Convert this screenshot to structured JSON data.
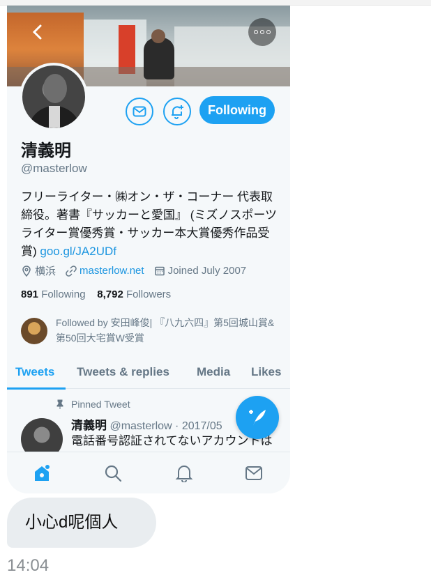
{
  "profile": {
    "name": "清義明",
    "handle": "@masterlow",
    "bio_text": "フリーライター・㈱オン・ザ・コーナー 代表取締役。著書『サッカーと愛国』 (ミズノスポーツライター賞優秀賞・サッカー本大賞優秀作品受賞) ",
    "bio_link": "goo.gl/JA2UDf",
    "location": "横浜",
    "website": "masterlow.net",
    "joined": "Joined July 2007",
    "following_count": "891",
    "following_label": "Following",
    "followers_count": "8,792",
    "followers_label": "Followers",
    "followed_by": "Followed by 安田峰俊| 『八九六四』第5回城山賞&第50回大宅賞W受賞"
  },
  "buttons": {
    "follow_label": "Following"
  },
  "tabs": [
    {
      "label": "Tweets"
    },
    {
      "label": "Tweets & replies"
    },
    {
      "label": "Media"
    },
    {
      "label": "Likes"
    }
  ],
  "pinned_tweet": {
    "pinned_label": "Pinned Tweet",
    "author": "清義明",
    "meta": "@masterlow · 2017/05",
    "text": "電話番号認証されてないアカウントは設定によりスパムアカウント扱い"
  },
  "chat": {
    "message": "小心d呢個人",
    "time": "14:04"
  },
  "icons": {
    "back": "back-arrow-icon",
    "more": "more-options-icon",
    "message": "envelope-icon",
    "notify": "bell-plus-icon",
    "compose": "compose-feather-icon",
    "home": "home-icon",
    "search": "search-icon",
    "notifications": "bell-icon",
    "messages": "mail-icon"
  },
  "colors": {
    "accent": "#1da1f2",
    "link": "#1b95e0",
    "secondary_text": "#657786",
    "bubble": "#e9edf0"
  }
}
